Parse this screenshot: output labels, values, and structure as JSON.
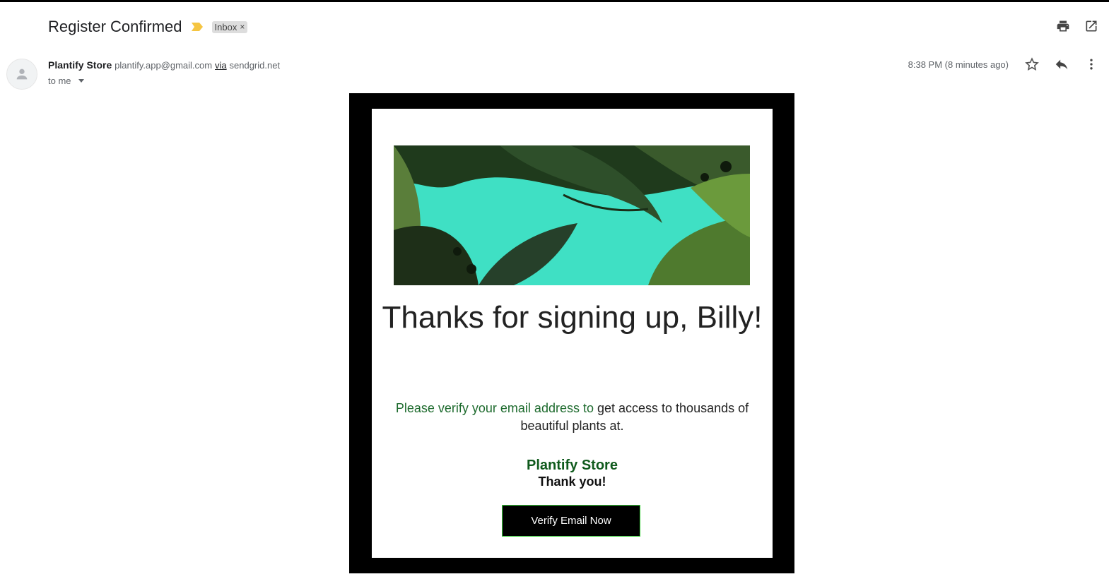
{
  "email": {
    "subject": "Register Confirmed",
    "label": "Inbox",
    "label_remove": "×",
    "sender_name": "Plantify Store",
    "sender_email": "plantify.app@gmail.com",
    "via_text": "via",
    "via_domain": "sendgrid.net",
    "recipient": "to me",
    "timestamp": "8:38 PM (8 minutes ago)"
  },
  "toolbar": {
    "icons": [
      "print-icon",
      "open-in-new-window-icon"
    ],
    "actions": [
      "star-icon",
      "reply-icon",
      "more-vert-icon"
    ]
  },
  "body": {
    "headline": "Thanks for signing up, Billy!",
    "message_highlight": "Please verify your email address to",
    "message_rest": " get access to thousands of beautiful plants at.",
    "brand": "Plantify Store",
    "thanks": "Thank you!",
    "cta_label": "Verify Email Now"
  },
  "colors": {
    "importance_marker": "#f5c542",
    "brand_green": "#0f5a1c",
    "message_green": "#1e6b2e",
    "cta_border": "#3bd13b",
    "frame": "#000000"
  }
}
